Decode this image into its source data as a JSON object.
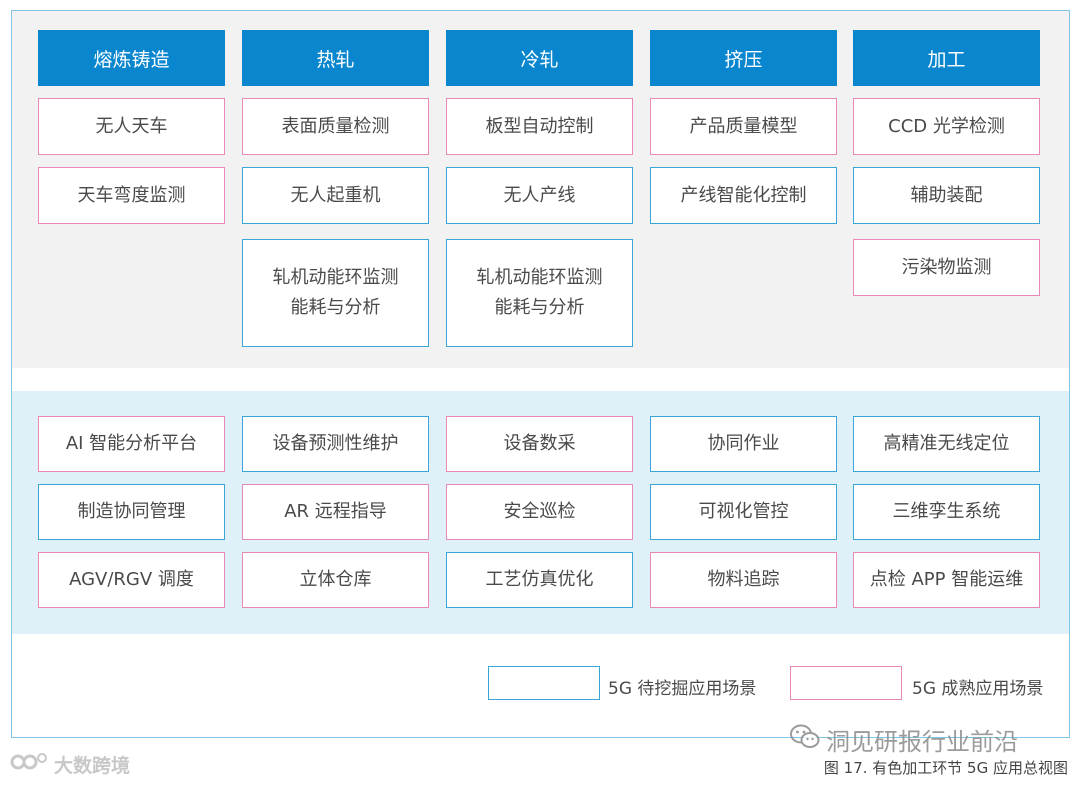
{
  "headers": [
    "熔炼铸造",
    "热轧",
    "冷轧",
    "挤压",
    "加工"
  ],
  "top_rows": [
    [
      "无人天车",
      "表面质量检测",
      "板型自动控制",
      "产品质量模型",
      "CCD 光学检测"
    ],
    [
      "天车弯度监测",
      "无人起重机",
      "无人产线",
      "产线智能化控制",
      "辅助装配"
    ]
  ],
  "top_row3": {
    "col2_line1": "轧机动能环监测",
    "col2_line2": "能耗与分析",
    "col3_line1": "轧机动能环监测",
    "col3_line2": "能耗与分析",
    "col5": "污染物监测"
  },
  "bottom_rows": [
    [
      "AI 智能分析平台",
      "设备预测性维护",
      "设备数采",
      "协同作业",
      "高精准无线定位"
    ],
    [
      "制造协同管理",
      "AR 远程指导",
      "安全巡检",
      "可视化管控",
      "三维孪生系统"
    ],
    [
      "AGV/RGV 调度",
      "立体仓库",
      "工艺仿真优化",
      "物料追踪",
      "点检 APP 智能运维"
    ]
  ],
  "legend": {
    "pending_label": "5G 待挖掘应用场景",
    "mature_label": "5G 成熟应用场景",
    "pending_color": "#3aa6d8",
    "mature_color": "#e88ab5"
  },
  "watermark_right": "洞见研报行业前沿",
  "watermark_left": "大数跨境",
  "caption": "图 17. 有色加工环节 5G 应用总视图",
  "colors": {
    "header_bg": "#0a86cf",
    "top_panel_bg": "#f2f2f3",
    "bottom_panel_bg": "#dff0f9"
  }
}
